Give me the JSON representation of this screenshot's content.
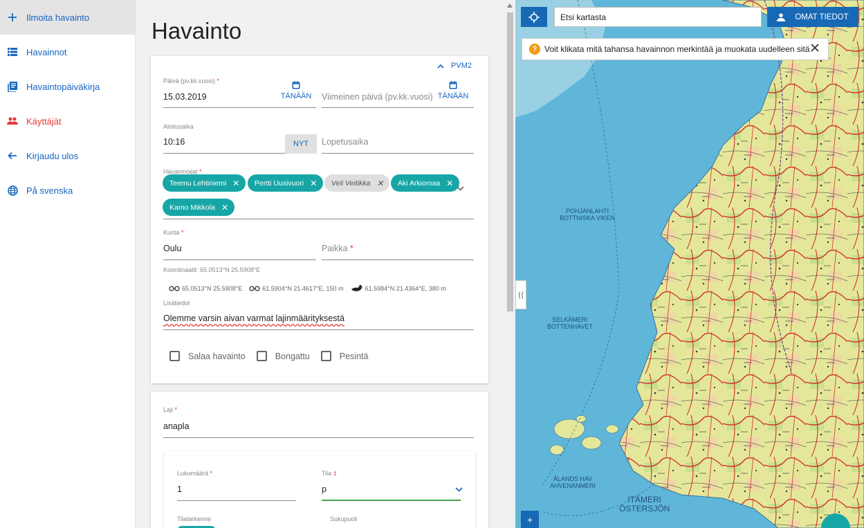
{
  "sidebar": {
    "items": [
      {
        "label": "Ilmoita havainto",
        "icon": "plus-icon"
      },
      {
        "label": "Havainnot",
        "icon": "list-icon"
      },
      {
        "label": "Havaintopäiväkirja",
        "icon": "book-icon"
      },
      {
        "label": "Käyttäjät",
        "icon": "users-icon"
      },
      {
        "label": "Kirjaudu ulos",
        "icon": "arrow-left-icon"
      },
      {
        "label": "På svenska",
        "icon": "globe-icon"
      }
    ]
  },
  "page": {
    "title": "Havainto"
  },
  "date_card": {
    "pvm2_label": "PVM2",
    "date_label": "Päivä (pv.kk.vuosi)",
    "date_value": "15.03.2019",
    "today_label": "TÄNÄÄN",
    "last_date_placeholder": "Viimeinen päivä (pv.kk.vuosi)",
    "today_label_2": "TÄNÄÄN",
    "start_time_label": "Aloitusaika",
    "start_time_value": "10:16",
    "now_label": "NYT",
    "end_time_placeholder": "Lopetusaika",
    "observers_label": "Havainnoijat",
    "observers": [
      {
        "name": "Teemu Lehtiniemi",
        "active": true
      },
      {
        "name": "Pertti Uusivuori",
        "active": true
      },
      {
        "name": "Veli Veitikka",
        "active": false
      },
      {
        "name": "Aki Arkiomaa",
        "active": true
      },
      {
        "name": "Kamo Mikkola",
        "active": true
      }
    ],
    "municipality_label": "Kunta",
    "municipality_value": "Oulu",
    "place_placeholder": "Paikka",
    "coordinates_label": "Koordinaatit: 65.0513°N 25.5908°E",
    "coord_entries": [
      "65.0513°N 25.5908°E",
      "61.5904°N 21.4617°E, 150 m",
      "61.5984°N 21.4364°E, 380 m"
    ],
    "notes_label": "Lisätiedot",
    "notes_value": "Olemme varsin aivan varmat lajinmäärityksestä",
    "checkboxes": [
      "Salaa havainto",
      "Bongattu",
      "Pesintä"
    ]
  },
  "species_card": {
    "species_label": "Laji",
    "species_value": "anapla",
    "count_label": "Lukumäärä",
    "count_value": "1",
    "state_label": "Tila",
    "state_req_mark": "‡",
    "state_value": "p",
    "state_detail_label": "Tilatarkenne",
    "sex_label": "Sukupuoli"
  },
  "map": {
    "search_placeholder": "Etsi kartasta",
    "my_info_label": "OMAT TIEDOT",
    "tip_text": "Voit klikata mitä tahansa havainnon merkintää ja muokata uudelleen sitä",
    "zoom_in": "+",
    "collapse_label": "⟨⟨",
    "sea_labels": {
      "gulf_bothnia": "POHJANLAHTI\nBOTTNISKA VIKEN",
      "selkameri": "SELKÄMERI\nBOTTENHAVET",
      "ahvenanmeri": "AHVENANMERI\nÅLANDS HAV",
      "itameri": "ITÄMERI\nÖSTERSJÖN"
    }
  },
  "colors": {
    "accent": "#1565c0",
    "teal": "#17a6a6",
    "map_blue": "#1769b5",
    "danger": "#e53935"
  }
}
